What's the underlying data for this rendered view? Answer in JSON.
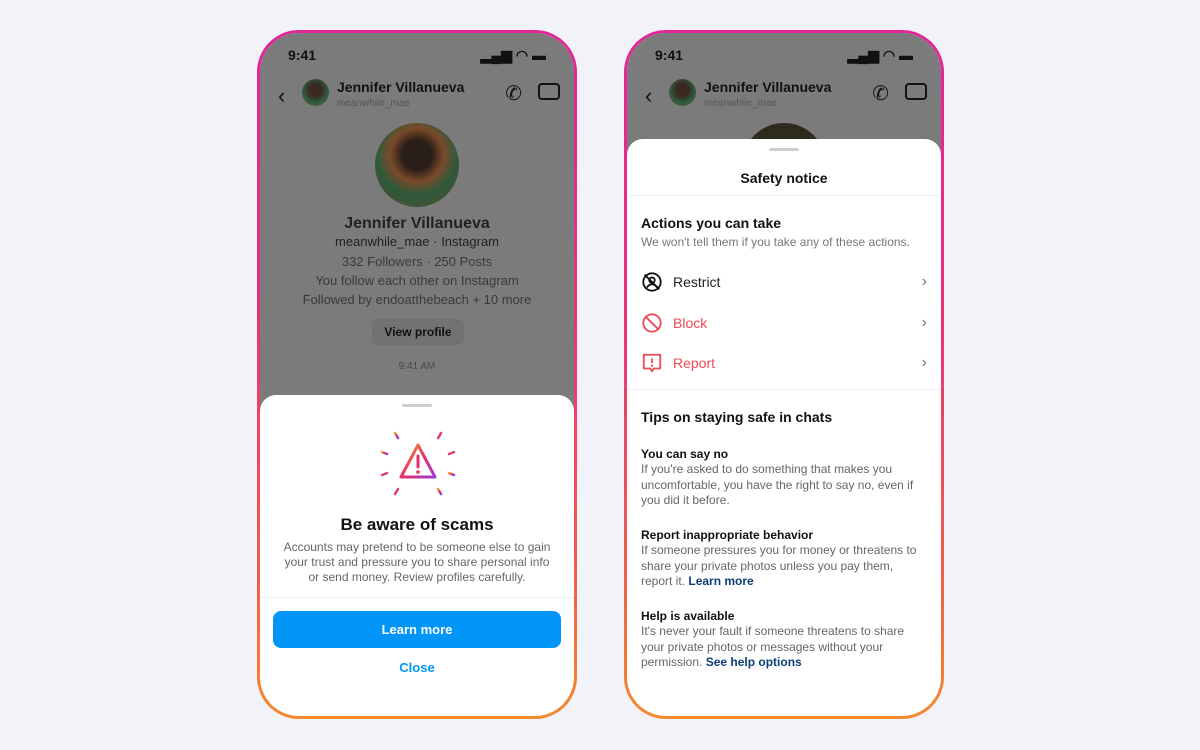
{
  "status": {
    "time": "9:41"
  },
  "chat": {
    "name": "Jennifer Villanueva",
    "username": "meanwhile_mae",
    "profile_line": "meanwhile_mae · Instagram",
    "stats": "332 Followers · 250 Posts",
    "mutual": "You follow each other on Instagram",
    "followed_by": "Followed by endoatthebeach + 10 more",
    "view_profile": "View profile",
    "timestamp": "9:41 AM"
  },
  "scam_sheet": {
    "title": "Be aware of scams",
    "body": "Accounts may pretend to be someone else to gain your trust and pressure you to share personal info or send money. Review profiles carefully.",
    "primary": "Learn more",
    "secondary": "Close",
    "accent": "#0095f6"
  },
  "safety_sheet": {
    "title": "Safety notice",
    "actions_heading": "Actions you can take",
    "actions_sub": "We won't tell them if you take any of these actions.",
    "actions": [
      {
        "label": "Restrict",
        "icon": "restrict-icon"
      },
      {
        "label": "Block",
        "icon": "block-icon"
      },
      {
        "label": "Report",
        "icon": "report-icon"
      }
    ],
    "danger_color": "#ed4956",
    "tips_heading": "Tips on staying safe in chats",
    "tips": [
      {
        "title": "You can say no",
        "body": "If you're asked to do something that makes you uncomfortable, you have the right to say no, even if you did it before.",
        "link": ""
      },
      {
        "title": "Report inappropriate behavior",
        "body": "If someone pressures you for money or threatens to share your private photos unless you pay them, report it.",
        "link": "Learn more"
      },
      {
        "title": "Help is available",
        "body": "It's never your fault if someone threatens to share your private photos or messages without your permission.",
        "link": "See help options"
      }
    ]
  }
}
